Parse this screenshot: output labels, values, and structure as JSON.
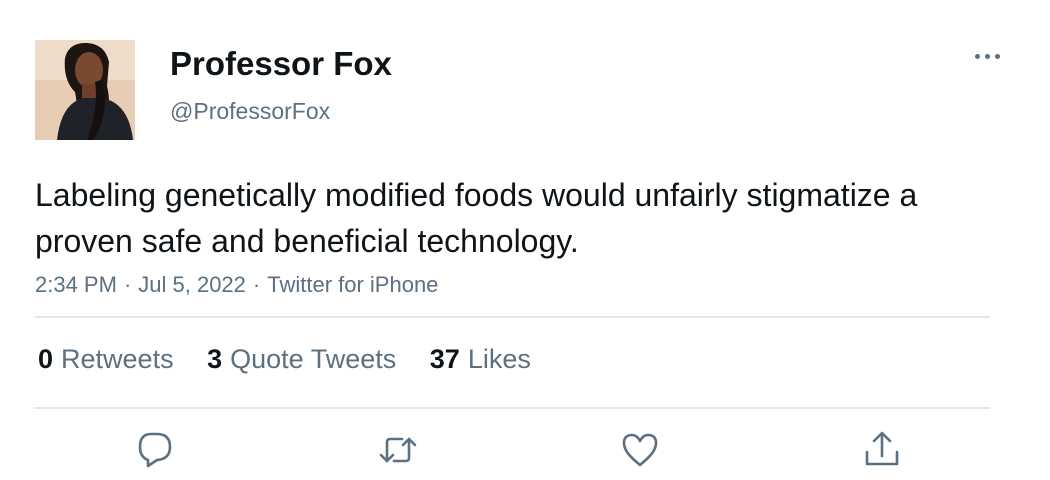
{
  "user": {
    "display_name": "Professor Fox",
    "handle": "@ProfessorFox"
  },
  "tweet": {
    "text": "Labeling genetically modified foods would unfairly stigmatize a proven safe and beneficial technology.",
    "time": "2:34 PM",
    "separator": "·",
    "date": "Jul 5, 2022",
    "source": "Twitter for iPhone"
  },
  "stats": {
    "retweets_count": "0",
    "retweets_label": "Retweets",
    "quotes_count": "3",
    "quotes_label": "Quote Tweets",
    "likes_count": "37",
    "likes_label": "Likes"
  },
  "icons": {
    "more": "more-horizontal-icon",
    "reply": "reply-icon",
    "retweet": "retweet-icon",
    "like": "heart-icon",
    "share": "share-icon"
  },
  "colors": {
    "text_primary": "#0f1419",
    "text_secondary": "#5b7083",
    "divider": "#e1e6ea",
    "background": "#ffffff"
  }
}
